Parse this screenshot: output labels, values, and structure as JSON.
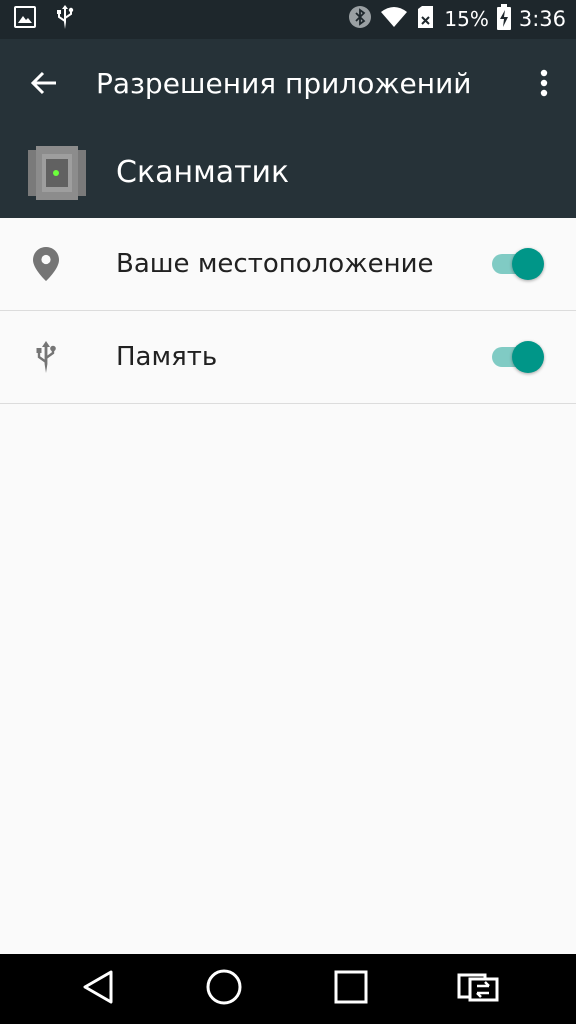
{
  "status_bar": {
    "left_icons": [
      "image-icon",
      "usb-icon"
    ],
    "right_icons": [
      "bluetooth-icon",
      "wifi-icon",
      "sd-card-icon",
      "battery-charging-icon"
    ],
    "battery_percent": "15%",
    "time": "3:36"
  },
  "app_bar": {
    "back_icon": "arrow-back-icon",
    "title": "Разрешения приложений",
    "overflow_icon": "more-vert-icon"
  },
  "app_header": {
    "icon": "scanmatik-app-icon",
    "name": "Сканматик"
  },
  "permissions": [
    {
      "icon": "location-pin-icon",
      "label": "Ваше местоположение",
      "enabled": true
    },
    {
      "icon": "usb-icon",
      "label": "Память",
      "enabled": true
    }
  ],
  "nav_bar": {
    "buttons": [
      "back-triangle-icon",
      "home-circle-icon",
      "recents-square-icon",
      "switch-apps-icon"
    ]
  },
  "colors": {
    "status_bar": "#1e272c",
    "app_bar": "#263238",
    "background": "#fafafa",
    "toggle_thumb": "#009688",
    "toggle_track": "#80cbc4",
    "nav_bar": "#000000"
  }
}
